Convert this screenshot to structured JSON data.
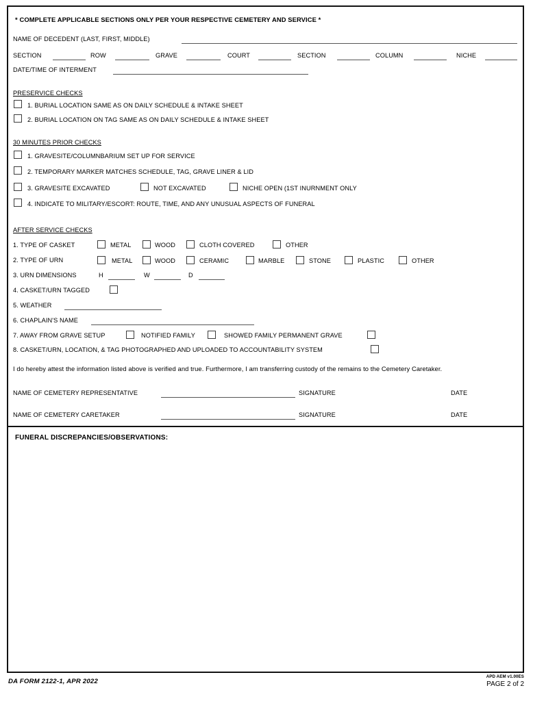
{
  "document": {
    "notice": "* COMPLETE APPLICABLE SECTIONS ONLY PER YOUR RESPECTIVE CEMETERY AND SERVICE *"
  },
  "identification": {
    "decedent_label": "NAME OF DECEDENT (LAST, FIRST, MIDDLE)",
    "decedent_value": "",
    "location_fields": [
      {
        "label": "SECTION",
        "value": ""
      },
      {
        "label": "ROW",
        "value": ""
      },
      {
        "label": "GRAVE",
        "value": ""
      },
      {
        "label": "COURT",
        "value": ""
      },
      {
        "label": "SECTION",
        "value": ""
      },
      {
        "label": "COLUMN",
        "value": ""
      },
      {
        "label": "NICHE",
        "value": ""
      }
    ],
    "interment_label": "DATE/TIME OF INTERMENT",
    "interment_value": ""
  },
  "preservice": {
    "heading": "PRESERVICE CHECKS",
    "items": [
      {
        "label": "1. BURIAL LOCATION SAME AS ON DAILY SCHEDULE & INTAKE SHEET",
        "checked": false
      },
      {
        "label": "2. BURIAL LOCATION ON TAG SAME AS ON DAILY SCHEDULE & INTAKE SHEET",
        "checked": false
      }
    ]
  },
  "thirty_minutes_prior": {
    "heading": "30 MINUTES PRIOR CHECKS",
    "item1": {
      "label": "1. GRAVESITE/COLUMNBARIUM SET UP FOR SERVICE",
      "checked": false
    },
    "item2": {
      "label": "2. TEMPORARY MARKER MATCHES SCHEDULE, TAG, GRAVE LINER & LID",
      "checked": false
    },
    "item3": {
      "options": [
        {
          "label": "3. GRAVESITE EXCAVATED",
          "checked": false
        },
        {
          "label": "NOT EXCAVATED",
          "checked": false
        },
        {
          "label": "NICHE OPEN (1ST INURNMENT ONLY",
          "checked": false
        }
      ]
    },
    "item4": {
      "label": "4. INDICATE TO MILITARY/ESCORT: ROUTE, TIME, AND ANY UNUSUAL ASPECTS OF FUNERAL",
      "checked": false
    }
  },
  "after_service": {
    "heading": "AFTER SERVICE CHECKS",
    "casket": {
      "label": "1. TYPE OF CASKET",
      "options": [
        {
          "label": "METAL",
          "checked": false
        },
        {
          "label": "WOOD",
          "checked": false
        },
        {
          "label": "CLOTH COVERED",
          "checked": false
        },
        {
          "label": "OTHER",
          "checked": false
        }
      ]
    },
    "urn": {
      "label": "2. TYPE OF URN",
      "options": [
        {
          "label": "METAL",
          "checked": false
        },
        {
          "label": "WOOD",
          "checked": false
        },
        {
          "label": "CERAMIC",
          "checked": false
        },
        {
          "label": "MARBLE",
          "checked": false
        },
        {
          "label": "STONE",
          "checked": false
        },
        {
          "label": "PLASTIC",
          "checked": false
        },
        {
          "label": "OTHER",
          "checked": false
        }
      ]
    },
    "urn_dimensions": {
      "label": "3. URN DIMENSIONS",
      "fields": [
        {
          "label": "H",
          "value": ""
        },
        {
          "label": "W",
          "value": ""
        },
        {
          "label": "D",
          "value": ""
        }
      ]
    },
    "tagged": {
      "label": "4. CASKET/URN TAGGED",
      "checked": false
    },
    "weather": {
      "label": "5. WEATHER",
      "value": ""
    },
    "chaplain": {
      "label": "6. CHAPLAIN'S NAME",
      "value": ""
    },
    "away_from_grave": {
      "options": [
        {
          "label": "7. AWAY FROM GRAVE SETUP",
          "checked": false
        },
        {
          "label": "NOTIFIED FAMILY",
          "checked": false
        },
        {
          "label": "SHOWED FAMILY PERMANENT GRAVE",
          "checked": false
        }
      ]
    },
    "photographed": {
      "label": "8. CASKET/URN, LOCATION, & TAG PHOTOGRAPHED AND UPLOADED TO ACCOUNTABILITY SYSTEM",
      "checked": false
    }
  },
  "attestation": {
    "statement": "I do hereby attest the information listed above is verified and true. Furthermore, I am transferring custody of the remains to the Cemetery Caretaker.",
    "rows": [
      {
        "name_label": "NAME OF CEMETERY REPRESENTATIVE",
        "name_value": "",
        "signature_label": "SIGNATURE",
        "date_label": "DATE"
      },
      {
        "name_label": "NAME OF CEMETERY CARETAKER",
        "name_value": "",
        "signature_label": "SIGNATURE",
        "date_label": "DATE"
      }
    ]
  },
  "discrepancies": {
    "title": "FUNERAL DISCREPANCIES/OBSERVATIONS:",
    "value": ""
  },
  "footer": {
    "form_id": "DA FORM 2122-1, APR 2022",
    "apd": "APD AEM v1.00ES",
    "page": "PAGE 2 of 2"
  }
}
